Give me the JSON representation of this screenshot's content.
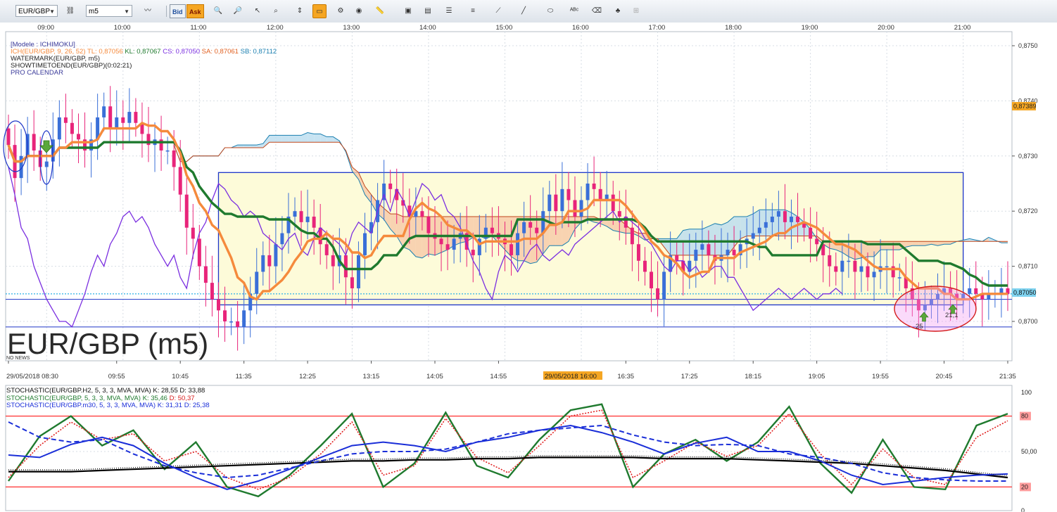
{
  "toolbar": {
    "symbol": "EUR/GBP",
    "timeframe": "m5",
    "bid_label": "Bid",
    "ask_label": "Ask"
  },
  "main_chart": {
    "time_top_labels": [
      "09:00",
      "10:00",
      "11:00",
      "12:00",
      "13:00",
      "14:00",
      "15:00",
      "16:00",
      "17:00",
      "18:00",
      "19:00",
      "20:00",
      "21:00"
    ],
    "time_bottom_labels": [
      "29/05/2018 08:30",
      "09:55",
      "10:45",
      "11:35",
      "12:25",
      "13:15",
      "14:05",
      "14:55",
      "16:35",
      "17:25",
      "18:15",
      "19:05",
      "19:55",
      "20:45",
      "21:35"
    ],
    "cursor_date_label": "29/05/2018 16:00",
    "price_ticks": [
      "0,8750",
      "0,8740",
      "0,8730",
      "0,8720",
      "0,8710",
      "0,8700"
    ],
    "price_highlight_high": "0,87389",
    "price_highlight_current": "0,87050",
    "big_title": "EUR/GBP (m5)",
    "no_news": "NO NEWS",
    "legend": {
      "line1": "[Modele : ICHIMOKU]",
      "ich_prefix": "ICH(EUR/GBP, 9, 26, 52)",
      "tl": "TL: 0,87056",
      "kl": "KL: 0,87067",
      "cs": "CS: 0,87050",
      "sa": "SA: 0,87061",
      "sb": "SB: 0,87112",
      "line3": "WATERMARK(EUR/GBP, m5)",
      "line4": "SHOWTIMETOEND(EUR/GBP)(0:02:21)",
      "line5": "PRO CALENDAR"
    },
    "annotations": {
      "arrow_label_1": "25",
      "arrow_label_2": "21,1"
    },
    "colors": {
      "tenkan": "#f58a3c",
      "kijun": "#1f7a2e",
      "chikou": "#7a2ee0",
      "cloud_bull": "#b9dcef",
      "cloud_bear": "#f6c9a6",
      "bull_candle": "#3a6fd8",
      "bear_candle": "#e8247a",
      "range_box": "#1d35c8",
      "box_fill": "#fdfbd9"
    }
  },
  "stoch_panel": {
    "legend": {
      "l1": "STOCHASTIC(EUR/GBP.H2, 5, 3, 3, MVA, MVA)",
      "l1_k": "K: 28,55",
      "l1_d": "D: 33,88",
      "l2": "STOCHASTIC(EUR/GBP, 5, 3, 3, MVA, MVA)",
      "l2_k": "K: 35,46",
      "l2_d": "D: 50,37",
      "l3": "STOCHASTIC(EUR/GBP.m30, 5, 3, 3, MVA, MVA)",
      "l3_k": "K: 31,31",
      "l3_d": "D: 25,38"
    },
    "ticks": [
      "100",
      "80",
      "50,00",
      "20",
      "0"
    ]
  },
  "chart_data": [
    {
      "type": "candlestick",
      "title": "EUR/GBP (m5)",
      "ylim": [
        0.8698,
        0.8751
      ],
      "x": [
        "08:30",
        "08:35",
        "08:40",
        "08:45",
        "08:50",
        "08:55",
        "09:00",
        "09:05",
        "09:10",
        "09:15",
        "09:20",
        "09:25",
        "09:30",
        "09:35",
        "09:40",
        "09:45",
        "09:50",
        "09:55",
        "10:00",
        "10:05",
        "10:10",
        "10:15",
        "10:20",
        "10:25",
        "10:30",
        "10:35",
        "10:40",
        "10:45",
        "10:50",
        "10:55",
        "11:00",
        "11:05",
        "11:10",
        "11:15",
        "11:20",
        "11:25",
        "11:30",
        "11:35",
        "11:40",
        "11:45",
        "11:50",
        "11:55",
        "12:00",
        "12:05",
        "12:10",
        "12:15",
        "12:20",
        "12:25",
        "12:30",
        "12:35",
        "12:40",
        "12:45",
        "12:50",
        "12:55",
        "13:00",
        "13:05",
        "13:10",
        "13:15",
        "13:20",
        "13:25",
        "13:30",
        "13:35",
        "13:40",
        "13:45",
        "13:50",
        "13:55",
        "14:00",
        "14:05",
        "14:10",
        "14:15",
        "14:20",
        "14:25",
        "14:30",
        "14:35",
        "14:40",
        "14:45",
        "14:50",
        "14:55",
        "15:00",
        "15:05",
        "15:10",
        "15:15",
        "15:20",
        "15:25",
        "15:30",
        "15:35",
        "15:40",
        "15:45",
        "15:50",
        "15:55",
        "16:00",
        "16:05",
        "16:10",
        "16:15",
        "16:20",
        "16:25",
        "16:30",
        "16:35",
        "16:40",
        "16:45",
        "16:50",
        "16:55",
        "17:00",
        "17:05",
        "17:10",
        "17:15",
        "17:20",
        "17:25",
        "17:30",
        "17:35",
        "17:40",
        "17:45",
        "17:50",
        "17:55",
        "18:00",
        "18:05",
        "18:10",
        "18:15",
        "18:20",
        "18:25",
        "18:30",
        "18:35",
        "18:40",
        "18:45",
        "18:50",
        "18:55",
        "19:00",
        "19:05",
        "19:10",
        "19:15",
        "19:20",
        "19:25",
        "19:30",
        "19:35",
        "19:40",
        "19:45",
        "19:50",
        "19:55",
        "20:00",
        "20:05",
        "20:10",
        "20:15",
        "20:20",
        "20:25",
        "20:30",
        "20:35",
        "20:40",
        "20:45",
        "20:50",
        "20:55",
        "21:00",
        "21:05",
        "21:10",
        "21:15",
        "21:20",
        "21:25",
        "21:30",
        "21:35",
        "21:40",
        "21:45"
      ],
      "close": [
        0.8732,
        0.8726,
        0.873,
        0.8734,
        0.8731,
        0.8728,
        0.8729,
        0.8733,
        0.8737,
        0.8736,
        0.8734,
        0.8733,
        0.8731,
        0.8733,
        0.8737,
        0.8739,
        0.8735,
        0.8737,
        0.8736,
        0.8738,
        0.8736,
        0.8734,
        0.8732,
        0.8733,
        0.8731,
        0.8731,
        0.8728,
        0.8723,
        0.8717,
        0.8715,
        0.871,
        0.8707,
        0.8704,
        0.8702,
        0.87,
        0.87,
        0.8699,
        0.8702,
        0.8705,
        0.8709,
        0.8712,
        0.871,
        0.8714,
        0.8716,
        0.8719,
        0.872,
        0.8718,
        0.8719,
        0.8717,
        0.8714,
        0.8712,
        0.871,
        0.8712,
        0.8708,
        0.8706,
        0.8712,
        0.8716,
        0.8718,
        0.8722,
        0.8725,
        0.8724,
        0.8722,
        0.8721,
        0.8719,
        0.872,
        0.8719,
        0.8716,
        0.8715,
        0.8714,
        0.8713,
        0.8715,
        0.8716,
        0.8713,
        0.8712,
        0.8715,
        0.8717,
        0.8716,
        0.8715,
        0.8714,
        0.8712,
        0.8716,
        0.8718,
        0.8717,
        0.8716,
        0.872,
        0.8723,
        0.872,
        0.8724,
        0.8722,
        0.8719,
        0.8722,
        0.8725,
        0.8724,
        0.8722,
        0.8723,
        0.872,
        0.8719,
        0.8717,
        0.8714,
        0.8711,
        0.8709,
        0.8706,
        0.8704,
        0.8709,
        0.8712,
        0.8711,
        0.8709,
        0.8711,
        0.8713,
        0.8714,
        0.8712,
        0.8711,
        0.8712,
        0.8713,
        0.8712,
        0.8714,
        0.8715,
        0.8716,
        0.8717,
        0.8718,
        0.8719,
        0.872,
        0.8718,
        0.8719,
        0.8718,
        0.8717,
        0.8715,
        0.8714,
        0.8712,
        0.871,
        0.8709,
        0.8711,
        0.8711,
        0.8709,
        0.871,
        0.8708,
        0.8709,
        0.871,
        0.871,
        0.8708,
        0.8708,
        0.8706,
        0.8704,
        0.8702,
        0.8703,
        0.8704,
        0.8705,
        0.8706,
        0.8705,
        0.8704,
        0.8705,
        0.8706,
        0.8705,
        0.8704,
        0.8705,
        0.8705,
        0.8706,
        0.8705
      ],
      "series": [
        {
          "name": "TL",
          "last": 0.87056
        },
        {
          "name": "KL",
          "last": 0.87067
        },
        {
          "name": "CS",
          "last": 0.8705
        },
        {
          "name": "SA",
          "last": 0.87061
        },
        {
          "name": "SB",
          "last": 0.87112
        }
      ],
      "horizontal_lines": [
        0.8705,
        0.8704,
        0.8699
      ],
      "range_box": {
        "x_start": "11:15",
        "x_end": "21:00",
        "top": 0.8727,
        "bottom": 0.8703
      }
    },
    {
      "type": "line",
      "ylim": [
        0,
        100
      ],
      "reference_lines": [
        20,
        80
      ],
      "x": [
        "08:30",
        "08:55",
        "09:20",
        "09:45",
        "10:10",
        "10:35",
        "11:00",
        "11:25",
        "11:50",
        "12:15",
        "12:40",
        "13:05",
        "13:30",
        "13:55",
        "14:20",
        "14:45",
        "15:10",
        "15:35",
        "16:00",
        "16:25",
        "16:50",
        "17:15",
        "17:40",
        "18:05",
        "18:30",
        "18:55",
        "19:20",
        "19:45",
        "20:10",
        "20:35",
        "21:00",
        "21:25",
        "21:45"
      ],
      "series": [
        {
          "name": "STOCHASTIC(EUR/GBP, 5, 3, 3, MVA, MVA) K",
          "values": [
            25,
            63,
            80,
            55,
            68,
            35,
            58,
            20,
            12,
            30,
            55,
            82,
            20,
            40,
            83,
            38,
            28,
            60,
            85,
            90,
            20,
            48,
            60,
            42,
            58,
            88,
            40,
            15,
            60,
            20,
            18,
            72,
            82
          ]
        },
        {
          "name": "STOCHASTIC(EUR/GBP, 5, 3, 3, MVA, MVA) D",
          "values": [
            28,
            55,
            75,
            60,
            65,
            42,
            50,
            28,
            18,
            28,
            48,
            75,
            30,
            38,
            78,
            45,
            32,
            55,
            80,
            85,
            28,
            42,
            58,
            46,
            55,
            82,
            48,
            22,
            52,
            28,
            22,
            62,
            76
          ]
        },
        {
          "name": "STOCHASTIC(EUR/GBP.H2, 5, 3, 3, MVA, MVA) K",
          "values": [
            33,
            33,
            33,
            34,
            35,
            36,
            37,
            38,
            39,
            40,
            41,
            42,
            42,
            43,
            43,
            44,
            44,
            45,
            45,
            45,
            45,
            44,
            44,
            44,
            43,
            42,
            41,
            40,
            38,
            36,
            34,
            31,
            28
          ]
        },
        {
          "name": "STOCHASTIC(EUR/GBP.m30, 5, 3, 3, MVA, MVA) K",
          "values": [
            47,
            45,
            56,
            62,
            55,
            40,
            28,
            18,
            25,
            35,
            45,
            55,
            58,
            55,
            50,
            58,
            62,
            68,
            72,
            66,
            58,
            48,
            57,
            62,
            50,
            50,
            42,
            30,
            22,
            25,
            28,
            30,
            31
          ]
        },
        {
          "name": "STOCHASTIC(EUR/GBP.m30, 5, 3, 3, MVA, MVA) D",
          "values": [
            75,
            62,
            58,
            60,
            48,
            38,
            32,
            28,
            30,
            36,
            42,
            48,
            50,
            50,
            52,
            58,
            65,
            68,
            70,
            72,
            64,
            58,
            55,
            56,
            55,
            48,
            45,
            40,
            32,
            28,
            26,
            25,
            25
          ]
        }
      ]
    }
  ]
}
